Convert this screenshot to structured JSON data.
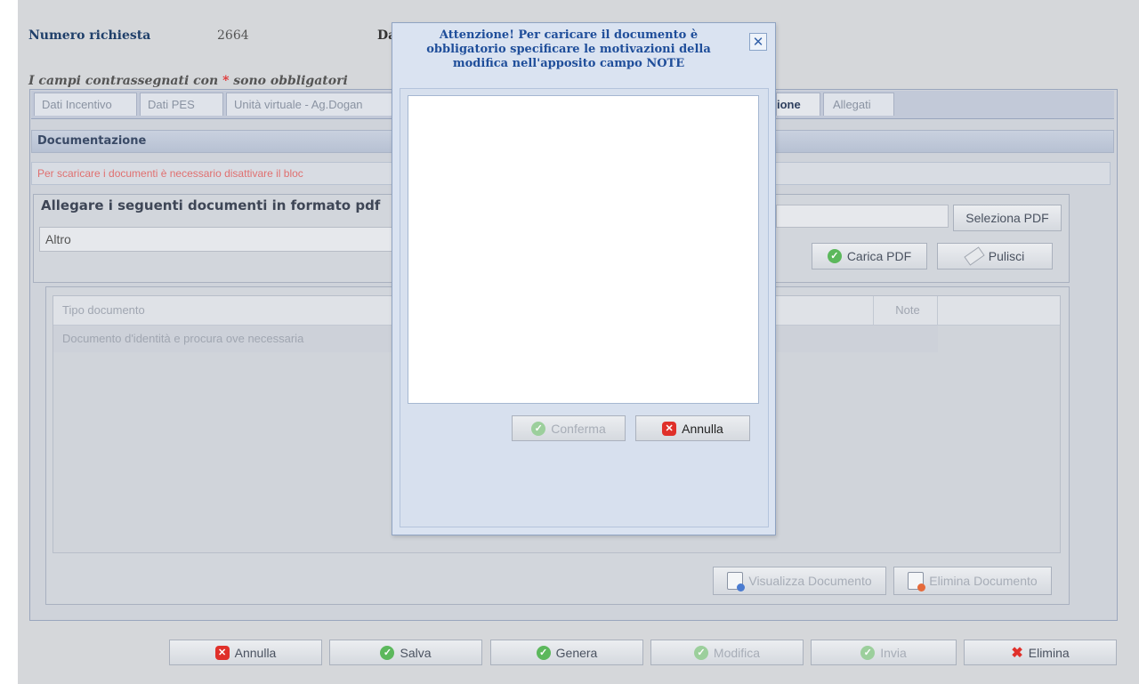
{
  "header": {
    "numero_label": "Numero richiesta",
    "numero_value": "2664",
    "da_label": "Da",
    "required_note_prefix": "I campi contrassegnati con ",
    "required_star": "*",
    "required_note_suffix": " sono obbligatori"
  },
  "tabs": [
    {
      "label": "Dati Incentivo"
    },
    {
      "label": "Dati PES"
    },
    {
      "label": "Unità virtuale - Ag.Dogan"
    },
    {
      "label": "ione"
    },
    {
      "label": "Allegati"
    }
  ],
  "documentazione": {
    "section_title": "Documentazione",
    "warning": "Per scaricare i documenti è necessario disattivare il bloc",
    "allegare_title": "Allegare i seguenti documenti in formato pdf",
    "tipo_value": "Altro",
    "seleziona_label": "Seleziona PDF",
    "carica_label": "Carica PDF",
    "pulisci_label": "Pulisci"
  },
  "grid": {
    "columns": [
      "Tipo documento",
      "Note"
    ],
    "rows": [
      {
        "tipo": "Documento d'identità e procura ove necessaria",
        "note": ""
      }
    ],
    "visualizza_label": "Visualizza Documento",
    "elimina_doc_label": "Elimina Documento"
  },
  "bottom_buttons": {
    "annulla": "Annulla",
    "salva": "Salva",
    "genera": "Genera",
    "modifica": "Modifica",
    "invia": "Invia",
    "elimina": "Elimina"
  },
  "modal": {
    "title": "Attenzione! Per caricare il documento è obbligatorio specificare le motivazioni della modifica nell'apposito campo NOTE",
    "note_value": "",
    "conferma_label": "Conferma",
    "annulla_label": "Annulla"
  },
  "icons": {
    "ok": "check-circle-icon",
    "cancel": "x-square-icon",
    "delete": "x-mark-icon",
    "close": "close-icon",
    "document": "document-icon",
    "eraser": "eraser-icon"
  },
  "colors": {
    "title_blue": "#1f4e9a",
    "warning_red": "#e07070",
    "required_star": "#e03030",
    "ok_green": "#5cb85c",
    "cancel_red": "#e0302a"
  }
}
